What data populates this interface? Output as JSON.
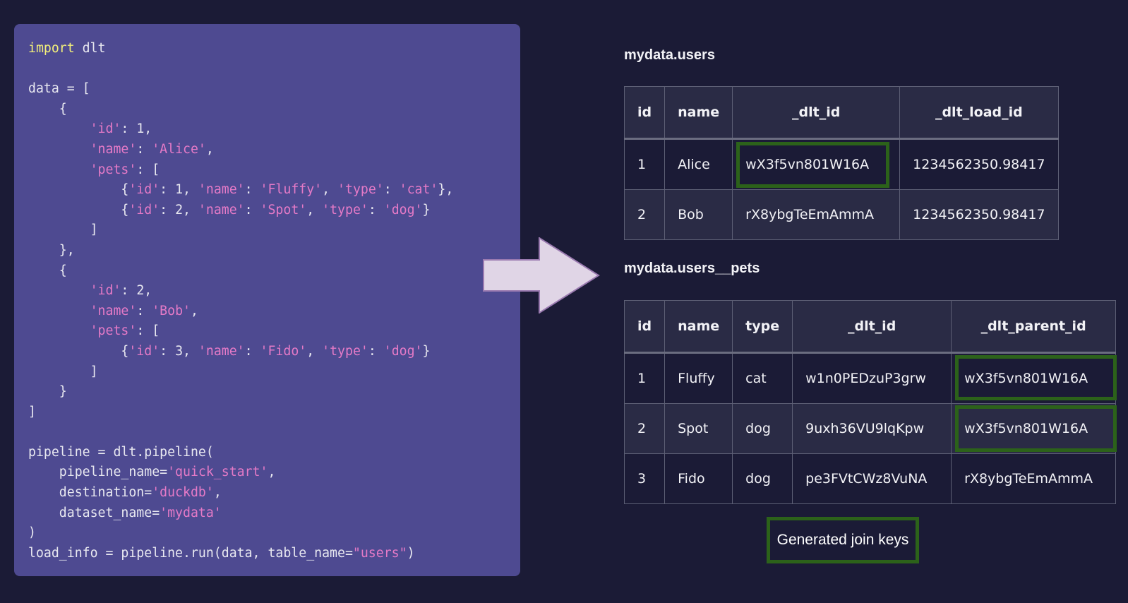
{
  "code": {
    "lines": [
      [
        {
          "t": "kw",
          "v": "import"
        },
        {
          "t": "plain",
          "v": " dlt"
        }
      ],
      [],
      [
        {
          "t": "plain",
          "v": "data = ["
        }
      ],
      [
        {
          "t": "plain",
          "v": "    {"
        }
      ],
      [
        {
          "t": "plain",
          "v": "        "
        },
        {
          "t": "str",
          "v": "'id'"
        },
        {
          "t": "plain",
          "v": ": 1,"
        }
      ],
      [
        {
          "t": "plain",
          "v": "        "
        },
        {
          "t": "str",
          "v": "'name'"
        },
        {
          "t": "plain",
          "v": ": "
        },
        {
          "t": "str",
          "v": "'Alice'"
        },
        {
          "t": "plain",
          "v": ","
        }
      ],
      [
        {
          "t": "plain",
          "v": "        "
        },
        {
          "t": "str",
          "v": "'pets'"
        },
        {
          "t": "plain",
          "v": ": ["
        }
      ],
      [
        {
          "t": "plain",
          "v": "            {"
        },
        {
          "t": "str",
          "v": "'id'"
        },
        {
          "t": "plain",
          "v": ": 1, "
        },
        {
          "t": "str",
          "v": "'name'"
        },
        {
          "t": "plain",
          "v": ": "
        },
        {
          "t": "str",
          "v": "'Fluffy'"
        },
        {
          "t": "plain",
          "v": ", "
        },
        {
          "t": "str",
          "v": "'type'"
        },
        {
          "t": "plain",
          "v": ": "
        },
        {
          "t": "str",
          "v": "'cat'"
        },
        {
          "t": "plain",
          "v": "},"
        }
      ],
      [
        {
          "t": "plain",
          "v": "            {"
        },
        {
          "t": "str",
          "v": "'id'"
        },
        {
          "t": "plain",
          "v": ": 2, "
        },
        {
          "t": "str",
          "v": "'name'"
        },
        {
          "t": "plain",
          "v": ": "
        },
        {
          "t": "str",
          "v": "'Spot'"
        },
        {
          "t": "plain",
          "v": ", "
        },
        {
          "t": "str",
          "v": "'type'"
        },
        {
          "t": "plain",
          "v": ": "
        },
        {
          "t": "str",
          "v": "'dog'"
        },
        {
          "t": "plain",
          "v": "}"
        }
      ],
      [
        {
          "t": "plain",
          "v": "        ]"
        }
      ],
      [
        {
          "t": "plain",
          "v": "    },"
        }
      ],
      [
        {
          "t": "plain",
          "v": "    {"
        }
      ],
      [
        {
          "t": "plain",
          "v": "        "
        },
        {
          "t": "str",
          "v": "'id'"
        },
        {
          "t": "plain",
          "v": ": 2,"
        }
      ],
      [
        {
          "t": "plain",
          "v": "        "
        },
        {
          "t": "str",
          "v": "'name'"
        },
        {
          "t": "plain",
          "v": ": "
        },
        {
          "t": "str",
          "v": "'Bob'"
        },
        {
          "t": "plain",
          "v": ","
        }
      ],
      [
        {
          "t": "plain",
          "v": "        "
        },
        {
          "t": "str",
          "v": "'pets'"
        },
        {
          "t": "plain",
          "v": ": ["
        }
      ],
      [
        {
          "t": "plain",
          "v": "            {"
        },
        {
          "t": "str",
          "v": "'id'"
        },
        {
          "t": "plain",
          "v": ": 3, "
        },
        {
          "t": "str",
          "v": "'name'"
        },
        {
          "t": "plain",
          "v": ": "
        },
        {
          "t": "str",
          "v": "'Fido'"
        },
        {
          "t": "plain",
          "v": ", "
        },
        {
          "t": "str",
          "v": "'type'"
        },
        {
          "t": "plain",
          "v": ": "
        },
        {
          "t": "str",
          "v": "'dog'"
        },
        {
          "t": "plain",
          "v": "}"
        }
      ],
      [
        {
          "t": "plain",
          "v": "        ]"
        }
      ],
      [
        {
          "t": "plain",
          "v": "    }"
        }
      ],
      [
        {
          "t": "plain",
          "v": "]"
        }
      ],
      [],
      [
        {
          "t": "plain",
          "v": "pipeline = dlt.pipeline("
        }
      ],
      [
        {
          "t": "plain",
          "v": "    pipeline_name="
        },
        {
          "t": "str",
          "v": "'quick_start'"
        },
        {
          "t": "plain",
          "v": ","
        }
      ],
      [
        {
          "t": "plain",
          "v": "    destination="
        },
        {
          "t": "str",
          "v": "'duckdb'"
        },
        {
          "t": "plain",
          "v": ","
        }
      ],
      [
        {
          "t": "plain",
          "v": "    dataset_name="
        },
        {
          "t": "str",
          "v": "'mydata'"
        }
      ],
      [
        {
          "t": "plain",
          "v": ")"
        }
      ],
      [
        {
          "t": "plain",
          "v": "load_info = pipeline.run(data, table_name="
        },
        {
          "t": "str",
          "v": "\"users\""
        },
        {
          "t": "plain",
          "v": ")"
        }
      ]
    ]
  },
  "users_table": {
    "title": "mydata.users",
    "columns": [
      "id",
      "name",
      "_dlt_id",
      "_dlt_load_id"
    ],
    "rows": [
      [
        "1",
        "Alice",
        "wX3f5vn801W16A",
        "1234562350.98417"
      ],
      [
        "2",
        "Bob",
        "rX8ybgTeEmAmmA",
        "1234562350.98417"
      ]
    ]
  },
  "pets_table": {
    "title": "mydata.users__pets",
    "columns": [
      "id",
      "name",
      "type",
      "_dlt_id",
      "_dlt_parent_id"
    ],
    "rows": [
      [
        "1",
        "Fluffy",
        "cat",
        "w1n0PEDzuP3grw",
        "wX3f5vn801W16A"
      ],
      [
        "2",
        "Spot",
        "dog",
        "9uxh36VU9lqKpw",
        "wX3f5vn801W16A"
      ],
      [
        "3",
        "Fido",
        "dog",
        "pe3FVtCWz8VuNA",
        "rX8ybgTeEmAmmA"
      ]
    ]
  },
  "legend": {
    "label": "Generated join keys",
    "highlight_color": "#2c621a"
  },
  "colors": {
    "background": "#1b1b36",
    "code_panel": "#4e4a91",
    "keyword": "#f3f07a",
    "string": "#e57ac7",
    "arrow_fill": "#e0d5e6",
    "arrow_stroke": "#9a7ab0"
  }
}
